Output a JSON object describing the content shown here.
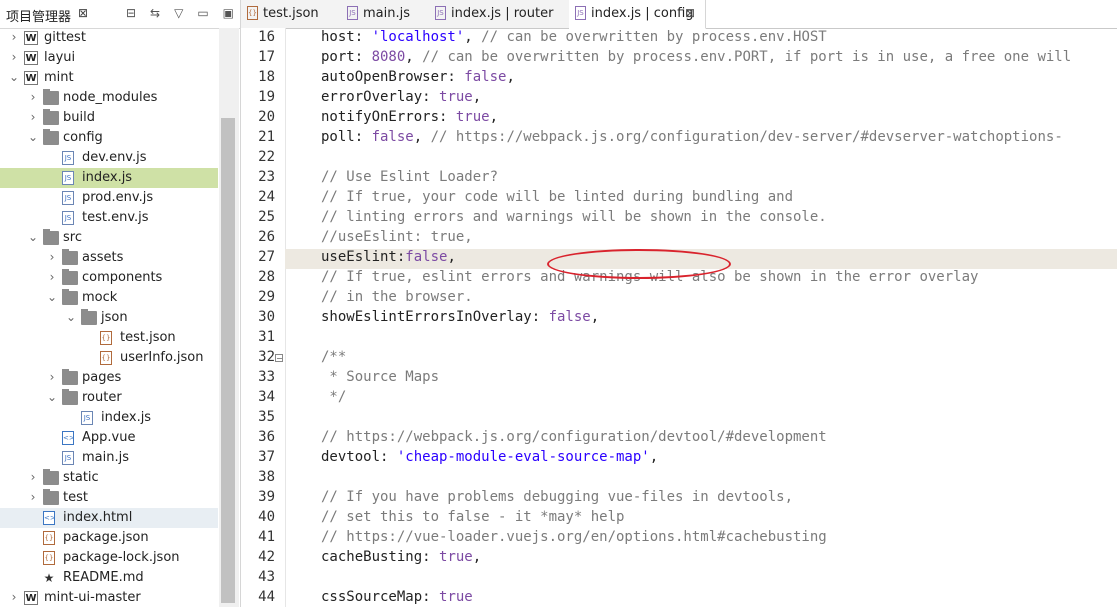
{
  "left_panel": {
    "title": "项目管理器",
    "close": "⊠",
    "icons": [
      "collapse-all-icon",
      "link-editor-icon",
      "view-menu-icon",
      "minimize-icon",
      "maximize-icon"
    ],
    "icon_glyphs": [
      "⊟",
      "⇆",
      "▽",
      "▭",
      "▣"
    ],
    "tree": [
      {
        "label": "gittest",
        "kind": "project",
        "level": 0,
        "arrow": "right"
      },
      {
        "label": "layui",
        "kind": "project",
        "level": 0,
        "arrow": "right"
      },
      {
        "label": "mint",
        "kind": "project",
        "level": 0,
        "arrow": "down"
      },
      {
        "label": "node_modules",
        "kind": "folder",
        "level": 1,
        "arrow": "right"
      },
      {
        "label": "build",
        "kind": "folder",
        "level": 1,
        "arrow": "right"
      },
      {
        "label": "config",
        "kind": "folder",
        "level": 1,
        "arrow": "down"
      },
      {
        "label": "dev.env.js",
        "kind": "js",
        "level": 2,
        "arrow": ""
      },
      {
        "label": "index.js",
        "kind": "js",
        "level": 2,
        "arrow": "",
        "selected": true
      },
      {
        "label": "prod.env.js",
        "kind": "js",
        "level": 2,
        "arrow": ""
      },
      {
        "label": "test.env.js",
        "kind": "js",
        "level": 2,
        "arrow": ""
      },
      {
        "label": "src",
        "kind": "folder",
        "level": 1,
        "arrow": "down"
      },
      {
        "label": "assets",
        "kind": "folder",
        "level": 2,
        "arrow": "right"
      },
      {
        "label": "components",
        "kind": "folder",
        "level": 2,
        "arrow": "right"
      },
      {
        "label": "mock",
        "kind": "folder",
        "level": 2,
        "arrow": "down"
      },
      {
        "label": "json",
        "kind": "folder",
        "level": 3,
        "arrow": "down"
      },
      {
        "label": "test.json",
        "kind": "json",
        "level": 4,
        "arrow": ""
      },
      {
        "label": "userInfo.json",
        "kind": "json",
        "level": 4,
        "arrow": ""
      },
      {
        "label": "pages",
        "kind": "folder",
        "level": 2,
        "arrow": "right"
      },
      {
        "label": "router",
        "kind": "folder",
        "level": 2,
        "arrow": "down"
      },
      {
        "label": "index.js",
        "kind": "js",
        "level": 3,
        "arrow": ""
      },
      {
        "label": "App.vue",
        "kind": "vue",
        "level": 2,
        "arrow": ""
      },
      {
        "label": "main.js",
        "kind": "js",
        "level": 2,
        "arrow": ""
      },
      {
        "label": "static",
        "kind": "folder",
        "level": 1,
        "arrow": "right"
      },
      {
        "label": "test",
        "kind": "folder",
        "level": 1,
        "arrow": "right"
      },
      {
        "label": "index.html",
        "kind": "html",
        "level": 1,
        "arrow": "",
        "hover": true
      },
      {
        "label": "package.json",
        "kind": "json",
        "level": 1,
        "arrow": ""
      },
      {
        "label": "package-lock.json",
        "kind": "json",
        "level": 1,
        "arrow": ""
      },
      {
        "label": "README.md",
        "kind": "md",
        "level": 1,
        "arrow": ""
      },
      {
        "label": "mint-ui-master",
        "kind": "project",
        "level": 0,
        "arrow": "right"
      }
    ]
  },
  "tabs": [
    {
      "label": "test.json",
      "kind": "json"
    },
    {
      "label": "main.js",
      "kind": "js"
    },
    {
      "label": "index.js | router",
      "kind": "js"
    },
    {
      "label": "index.js | config",
      "kind": "js",
      "active": true,
      "close": "⊠"
    }
  ],
  "editor": {
    "highlight_line": 27,
    "lines": [
      {
        "n": 16,
        "parts": [
          [
            "k",
            "host: "
          ],
          [
            "s",
            "'localhost'"
          ],
          [
            "k",
            ", "
          ],
          [
            "c",
            "// can be overwritten by process.env.HOST"
          ]
        ]
      },
      {
        "n": 17,
        "parts": [
          [
            "k",
            "port: "
          ],
          [
            "n",
            "8080"
          ],
          [
            "k",
            ", "
          ],
          [
            "c",
            "// can be overwritten by process.env.PORT, if port is in use, a free one will"
          ]
        ]
      },
      {
        "n": 18,
        "parts": [
          [
            "k",
            "autoOpenBrowser: "
          ],
          [
            "n",
            "false"
          ],
          [
            "k",
            ","
          ]
        ]
      },
      {
        "n": 19,
        "parts": [
          [
            "k",
            "errorOverlay: "
          ],
          [
            "n",
            "true"
          ],
          [
            "k",
            ","
          ]
        ]
      },
      {
        "n": 20,
        "parts": [
          [
            "k",
            "notifyOnErrors: "
          ],
          [
            "n",
            "true"
          ],
          [
            "k",
            ","
          ]
        ]
      },
      {
        "n": 21,
        "parts": [
          [
            "k",
            "poll: "
          ],
          [
            "n",
            "false"
          ],
          [
            "k",
            ", "
          ],
          [
            "c",
            "// https://webpack.js.org/configuration/dev-server/#devserver-watchoptions-"
          ]
        ]
      },
      {
        "n": 22,
        "parts": []
      },
      {
        "n": 23,
        "parts": [
          [
            "c",
            "// Use Eslint Loader?"
          ]
        ]
      },
      {
        "n": 24,
        "parts": [
          [
            "c",
            "// If true, your code will be linted during bundling and"
          ]
        ]
      },
      {
        "n": 25,
        "parts": [
          [
            "c",
            "// linting errors and warnings will be shown in the console."
          ]
        ]
      },
      {
        "n": 26,
        "parts": [
          [
            "c",
            "//useEslint: true,"
          ]
        ]
      },
      {
        "n": 27,
        "parts": [
          [
            "k",
            "useEslint:"
          ],
          [
            "n",
            "false"
          ],
          [
            "k",
            ","
          ]
        ]
      },
      {
        "n": 28,
        "parts": [
          [
            "c",
            "// If true, eslint errors and warnings will also be shown in the error overlay"
          ]
        ]
      },
      {
        "n": 29,
        "parts": [
          [
            "c",
            "// in the browser."
          ]
        ]
      },
      {
        "n": 30,
        "parts": [
          [
            "k",
            "showEslintErrorsInOverlay: "
          ],
          [
            "n",
            "false"
          ],
          [
            "k",
            ","
          ]
        ]
      },
      {
        "n": 31,
        "parts": []
      },
      {
        "n": 32,
        "parts": [
          [
            "c",
            "/**"
          ]
        ],
        "fold": "⊟"
      },
      {
        "n": 33,
        "parts": [
          [
            "c",
            " * Source Maps"
          ]
        ]
      },
      {
        "n": 34,
        "parts": [
          [
            "c",
            " */"
          ]
        ]
      },
      {
        "n": 35,
        "parts": []
      },
      {
        "n": 36,
        "parts": [
          [
            "c",
            "// https://webpack.js.org/configuration/devtool/#development"
          ]
        ]
      },
      {
        "n": 37,
        "parts": [
          [
            "k",
            "devtool: "
          ],
          [
            "s",
            "'cheap-module-eval-source-map'"
          ],
          [
            "k",
            ","
          ]
        ]
      },
      {
        "n": 38,
        "parts": []
      },
      {
        "n": 39,
        "parts": [
          [
            "c",
            "// If you have problems debugging vue-files in devtools,"
          ]
        ]
      },
      {
        "n": 40,
        "parts": [
          [
            "c",
            "// set this to false - it *may* help"
          ]
        ]
      },
      {
        "n": 41,
        "parts": [
          [
            "c",
            "// https://vue-loader.vuejs.org/en/options.html#cachebusting"
          ]
        ]
      },
      {
        "n": 42,
        "parts": [
          [
            "k",
            "cacheBusting: "
          ],
          [
            "n",
            "true"
          ],
          [
            "k",
            ","
          ]
        ]
      },
      {
        "n": 43,
        "parts": []
      },
      {
        "n": 44,
        "parts": [
          [
            "k",
            "cssSourceMap: "
          ],
          [
            "n",
            "true"
          ]
        ]
      }
    ]
  }
}
